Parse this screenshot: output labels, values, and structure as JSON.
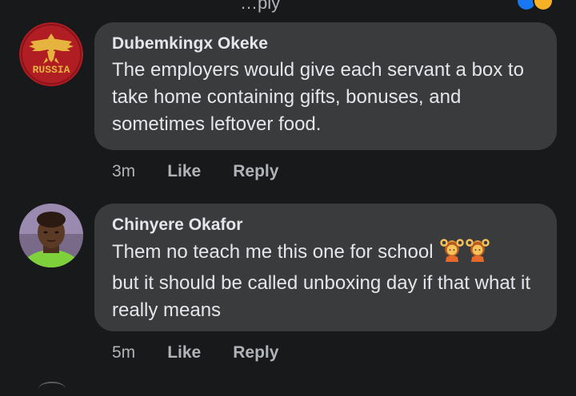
{
  "header_fragment": {
    "text": "…ply"
  },
  "colors": {
    "background": "#18191a",
    "bubble": "#3a3b3c",
    "text_primary": "#e4e6eb",
    "text_secondary": "#b0b3b8",
    "russia_red": "#b01d23",
    "russia_gold": "#e6b33f"
  },
  "comments": [
    {
      "author": "Dubemkingx Okeke",
      "avatar_label": "RUSSIA",
      "avatar_icon": "double-headed-eagle-icon",
      "text": "The employers would give each servant a box to take home containing gifts, bonuses, and sometimes leftover food.",
      "time": "3m",
      "like_label": "Like",
      "reply_label": "Reply"
    },
    {
      "author": "Chinyere Okafor",
      "avatar_icon": "profile-photo",
      "text": "Them no teach me this one for school",
      "emoji": [
        "person-gesturing-ok-emoji",
        "person-gesturing-ok-emoji"
      ],
      "text_after_emoji": "but it should be called unboxing day if that what it really means",
      "time": "5m",
      "like_label": "Like",
      "reply_label": "Reply"
    }
  ]
}
